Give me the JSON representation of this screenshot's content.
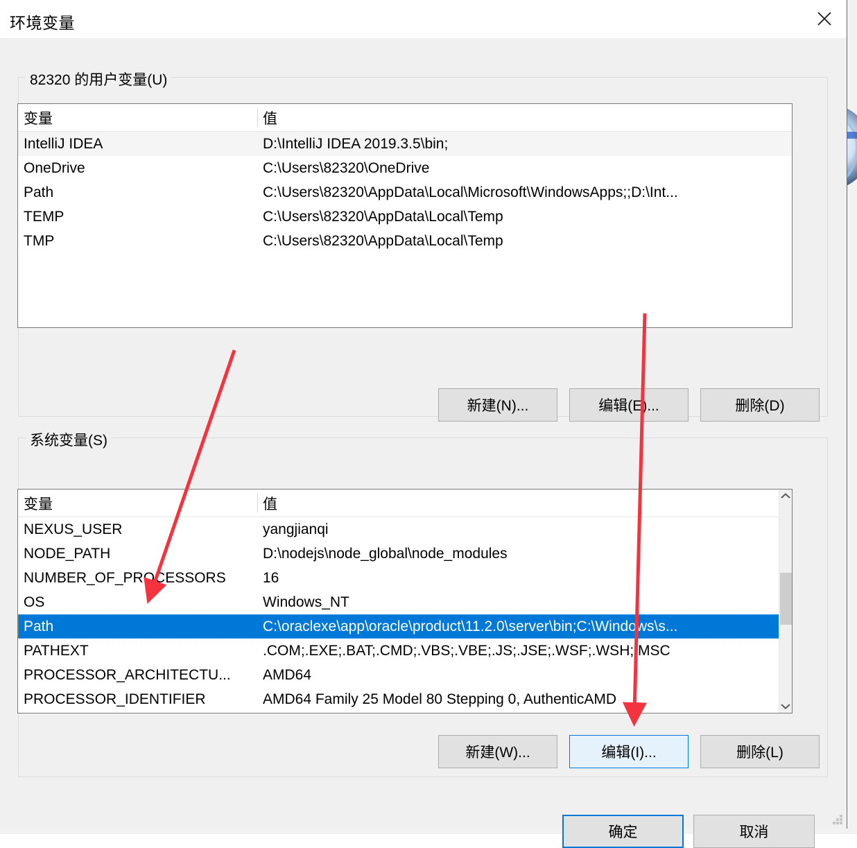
{
  "window": {
    "title": "环境变量",
    "close_icon": "close-icon"
  },
  "user_section": {
    "label": "82320 的用户变量(U)",
    "columns": [
      "变量",
      "值"
    ],
    "rows": [
      {
        "name": "IntelliJ IDEA",
        "value": "D:\\IntelliJ IDEA 2019.3.5\\bin;",
        "selected_style": true
      },
      {
        "name": "OneDrive",
        "value": "C:\\Users\\82320\\OneDrive",
        "selected_style": false
      },
      {
        "name": "Path",
        "value": "C:\\Users\\82320\\AppData\\Local\\Microsoft\\WindowsApps;;D:\\Int...",
        "selected_style": false
      },
      {
        "name": "TEMP",
        "value": "C:\\Users\\82320\\AppData\\Local\\Temp",
        "selected_style": false
      },
      {
        "name": "TMP",
        "value": "C:\\Users\\82320\\AppData\\Local\\Temp",
        "selected_style": false
      }
    ],
    "buttons": {
      "new": "新建(N)...",
      "edit": "编辑(E)...",
      "delete": "删除(D)"
    }
  },
  "system_section": {
    "label": "系统变量(S)",
    "columns": [
      "变量",
      "值"
    ],
    "rows": [
      {
        "name": "NEXUS_USER",
        "value": "yangjianqi",
        "selected": false
      },
      {
        "name": "NODE_PATH",
        "value": " D:\\nodejs\\node_global\\node_modules",
        "selected": false
      },
      {
        "name": "NUMBER_OF_PROCESSORS",
        "value": "16",
        "selected": false
      },
      {
        "name": "OS",
        "value": "Windows_NT",
        "selected": false
      },
      {
        "name": "Path",
        "value": "C:\\oraclexe\\app\\oracle\\product\\11.2.0\\server\\bin;C:\\Windows\\s...",
        "selected": true
      },
      {
        "name": "PATHEXT",
        "value": ".COM;.EXE;.BAT;.CMD;.VBS;.VBE;.JS;.JSE;.WSF;.WSH;.MSC",
        "selected": false
      },
      {
        "name": "PROCESSOR_ARCHITECTU...",
        "value": "AMD64",
        "selected": false
      },
      {
        "name": "PROCESSOR_IDENTIFIER",
        "value": "AMD64 Family 25 Model 80 Stepping 0, AuthenticAMD",
        "selected": false
      }
    ],
    "buttons": {
      "new": "新建(W)...",
      "edit": "编辑(I)...",
      "delete": "删除(L)"
    },
    "scrollbar": {
      "up_icon": "chevron-up-icon",
      "down_icon": "chevron-down-icon"
    }
  },
  "footer": {
    "ok": "确定",
    "cancel": "取消"
  },
  "colors": {
    "accent": "#0078d7",
    "selection": "#0078d7",
    "dialog_bg": "#f0f0f0",
    "button_bg": "#e1e1e1",
    "focus_bg": "#e5f1fb",
    "annotation_red": "#f5333f"
  },
  "annotations": [
    {
      "name": "arrow-to-system-path-row",
      "color": "#f5333f"
    },
    {
      "name": "arrow-to-system-edit-button",
      "color": "#f5333f"
    }
  ]
}
